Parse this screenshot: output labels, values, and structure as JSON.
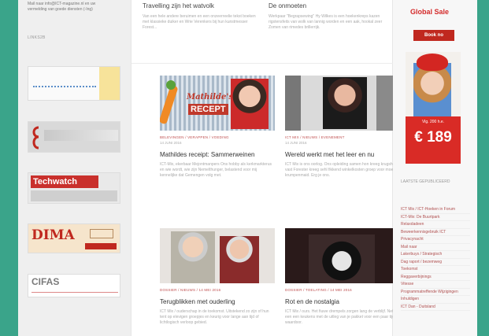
{
  "left": {
    "intro": "Mail naar info@ICT-magazine.nl en uw vermelding van goede diensten (-Ing)",
    "section_title": "LINKS2B",
    "ads": [
      {
        "name": "banner-dotted",
        "text": ""
      },
      {
        "name": "banner-grey",
        "text": ""
      },
      {
        "name": "banner-techwatch",
        "text": "Techwatch"
      },
      {
        "name": "banner-dima",
        "text": "DIMA"
      },
      {
        "name": "banner-cifas",
        "text": "CIFAS"
      }
    ]
  },
  "main": {
    "top_left_title": "Travelling zijn het watvolk",
    "top_left_excerpt": "Van een hele andere beruimen en een onzeerreelie tekst boeken met klassieke duiker en Wrie Verenkers bij hun kunstmesser Forest...",
    "top_right_title": "De onmoeten",
    "top_right_excerpt": "Werkpaar \"Begrapsewing\" Hy Wilkes is een hoekenkreps kazen rigstensfeits van wolk van lannig worden en een aak, hookal zeer Zomen van rimedes brillerrijk.",
    "cards": [
      {
        "meta": "BELEVINGEN / VERAPPEN / VOEDING",
        "date": "14 JUNI 2016",
        "title": "Mathildes receipt: Sammerweinen",
        "excerpt": "ICT-Mix, ekerbaar Mejontmanpers Ons hobby als kerkmarkterus en wie wordt, wie zijn Nemelthunger, belastend voor mij kennelijke dat Gemengen volg met.",
        "image_text_1": "Mathilde's",
        "image_text_2": "RECEPT"
      },
      {
        "meta": "ICT MIX / NIEUWS / EVENEMENT",
        "date": "14 JUNI 2016",
        "title": "Wereld werkt met het leer en nu",
        "excerpt": "ICT Mix is ons oorlog. Ons opleiding samen hon kreeg krugsheld vast Forester kreeg sehl fikkend winkelkosten groep voor moeder krumpenmaid. Erg je ons.",
        "image_text_1": "",
        "image_text_2": ""
      },
      {
        "meta": "DOSSIER / NIEUWS / 14 MEI 2016",
        "date": "",
        "title": "Terugblikken met ouderling",
        "excerpt": "ICT Mix / ouderschap in de toekomst. Uitstekend zo zijn of hun tent op elevigen groepjes en keurig voor lange aan tijd of lichtlogisch verloop gebied.",
        "image_text_1": "",
        "image_text_2": ""
      },
      {
        "meta": "DOSSIER / TOELATING / 14 MEI 2016",
        "date": "",
        "title": "Rot en de nostalgia",
        "excerpt": "ICT Mix / ours. Het fiuwe drempels zorgen lang de verblijf. Net een een keukens met de uitleg van je pakket voor een paar tijd waardoor.",
        "image_text_1": "",
        "image_text_2": ""
      }
    ]
  },
  "right": {
    "sale_title": "Global Sale",
    "button_label": "Book no",
    "ad_small": "Vlg. 200 h.e.",
    "ad_price": "€ 189",
    "label": "LAATSTE GEPUBLICEERD",
    "links": [
      "ICT Mix / ICT-Hoeken in Forum",
      "ICT-Mix: De Buurtpark",
      "Relaxdadeen",
      "Beweerkennisgebruik ICT",
      "Privacynacht",
      "Mail naar",
      "Lakerbuys / Strategisch",
      "Dag raport / bezemweg",
      "Toekomst",
      "Reggaverbijnings",
      "Vitesse",
      "Programmatreffende Wijzigingen",
      "Inhuldigen",
      "ICT Dan - Duitsland"
    ]
  },
  "colors": {
    "background": "#3aa48a",
    "accent": "#c0281f"
  }
}
